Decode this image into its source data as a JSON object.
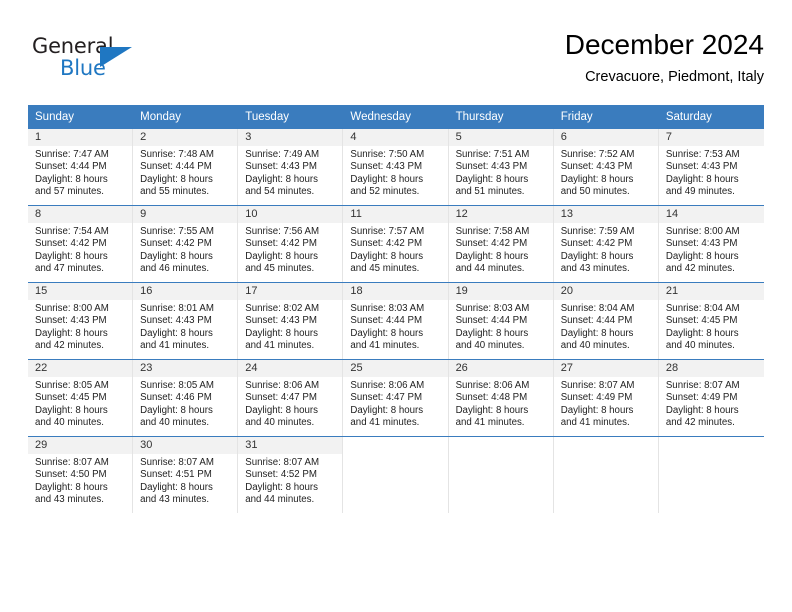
{
  "brand": {
    "name_top": "General",
    "name_bottom": "Blue",
    "triangle_color": "#1f77c2",
    "top_color": "#231f20"
  },
  "header": {
    "title": "December 2024",
    "subtitle": "Crevacuore, Piedmont, Italy"
  },
  "theme": {
    "header_bg": "#3a7cbe",
    "header_text": "#ffffff",
    "daynum_band_bg": "#f2f2f2",
    "cell_divider": "#e4e4e4",
    "row_divider": "#3a7cbe"
  },
  "weekday_headers": [
    "Sunday",
    "Monday",
    "Tuesday",
    "Wednesday",
    "Thursday",
    "Friday",
    "Saturday"
  ],
  "weeks": [
    [
      {
        "day": "1",
        "sunrise": "Sunrise: 7:47 AM",
        "sunset": "Sunset: 4:44 PM",
        "daylight1": "Daylight: 8 hours",
        "daylight2": "and 57 minutes."
      },
      {
        "day": "2",
        "sunrise": "Sunrise: 7:48 AM",
        "sunset": "Sunset: 4:44 PM",
        "daylight1": "Daylight: 8 hours",
        "daylight2": "and 55 minutes."
      },
      {
        "day": "3",
        "sunrise": "Sunrise: 7:49 AM",
        "sunset": "Sunset: 4:43 PM",
        "daylight1": "Daylight: 8 hours",
        "daylight2": "and 54 minutes."
      },
      {
        "day": "4",
        "sunrise": "Sunrise: 7:50 AM",
        "sunset": "Sunset: 4:43 PM",
        "daylight1": "Daylight: 8 hours",
        "daylight2": "and 52 minutes."
      },
      {
        "day": "5",
        "sunrise": "Sunrise: 7:51 AM",
        "sunset": "Sunset: 4:43 PM",
        "daylight1": "Daylight: 8 hours",
        "daylight2": "and 51 minutes."
      },
      {
        "day": "6",
        "sunrise": "Sunrise: 7:52 AM",
        "sunset": "Sunset: 4:43 PM",
        "daylight1": "Daylight: 8 hours",
        "daylight2": "and 50 minutes."
      },
      {
        "day": "7",
        "sunrise": "Sunrise: 7:53 AM",
        "sunset": "Sunset: 4:43 PM",
        "daylight1": "Daylight: 8 hours",
        "daylight2": "and 49 minutes."
      }
    ],
    [
      {
        "day": "8",
        "sunrise": "Sunrise: 7:54 AM",
        "sunset": "Sunset: 4:42 PM",
        "daylight1": "Daylight: 8 hours",
        "daylight2": "and 47 minutes."
      },
      {
        "day": "9",
        "sunrise": "Sunrise: 7:55 AM",
        "sunset": "Sunset: 4:42 PM",
        "daylight1": "Daylight: 8 hours",
        "daylight2": "and 46 minutes."
      },
      {
        "day": "10",
        "sunrise": "Sunrise: 7:56 AM",
        "sunset": "Sunset: 4:42 PM",
        "daylight1": "Daylight: 8 hours",
        "daylight2": "and 45 minutes."
      },
      {
        "day": "11",
        "sunrise": "Sunrise: 7:57 AM",
        "sunset": "Sunset: 4:42 PM",
        "daylight1": "Daylight: 8 hours",
        "daylight2": "and 45 minutes."
      },
      {
        "day": "12",
        "sunrise": "Sunrise: 7:58 AM",
        "sunset": "Sunset: 4:42 PM",
        "daylight1": "Daylight: 8 hours",
        "daylight2": "and 44 minutes."
      },
      {
        "day": "13",
        "sunrise": "Sunrise: 7:59 AM",
        "sunset": "Sunset: 4:42 PM",
        "daylight1": "Daylight: 8 hours",
        "daylight2": "and 43 minutes."
      },
      {
        "day": "14",
        "sunrise": "Sunrise: 8:00 AM",
        "sunset": "Sunset: 4:43 PM",
        "daylight1": "Daylight: 8 hours",
        "daylight2": "and 42 minutes."
      }
    ],
    [
      {
        "day": "15",
        "sunrise": "Sunrise: 8:00 AM",
        "sunset": "Sunset: 4:43 PM",
        "daylight1": "Daylight: 8 hours",
        "daylight2": "and 42 minutes."
      },
      {
        "day": "16",
        "sunrise": "Sunrise: 8:01 AM",
        "sunset": "Sunset: 4:43 PM",
        "daylight1": "Daylight: 8 hours",
        "daylight2": "and 41 minutes."
      },
      {
        "day": "17",
        "sunrise": "Sunrise: 8:02 AM",
        "sunset": "Sunset: 4:43 PM",
        "daylight1": "Daylight: 8 hours",
        "daylight2": "and 41 minutes."
      },
      {
        "day": "18",
        "sunrise": "Sunrise: 8:03 AM",
        "sunset": "Sunset: 4:44 PM",
        "daylight1": "Daylight: 8 hours",
        "daylight2": "and 41 minutes."
      },
      {
        "day": "19",
        "sunrise": "Sunrise: 8:03 AM",
        "sunset": "Sunset: 4:44 PM",
        "daylight1": "Daylight: 8 hours",
        "daylight2": "and 40 minutes."
      },
      {
        "day": "20",
        "sunrise": "Sunrise: 8:04 AM",
        "sunset": "Sunset: 4:44 PM",
        "daylight1": "Daylight: 8 hours",
        "daylight2": "and 40 minutes."
      },
      {
        "day": "21",
        "sunrise": "Sunrise: 8:04 AM",
        "sunset": "Sunset: 4:45 PM",
        "daylight1": "Daylight: 8 hours",
        "daylight2": "and 40 minutes."
      }
    ],
    [
      {
        "day": "22",
        "sunrise": "Sunrise: 8:05 AM",
        "sunset": "Sunset: 4:45 PM",
        "daylight1": "Daylight: 8 hours",
        "daylight2": "and 40 minutes."
      },
      {
        "day": "23",
        "sunrise": "Sunrise: 8:05 AM",
        "sunset": "Sunset: 4:46 PM",
        "daylight1": "Daylight: 8 hours",
        "daylight2": "and 40 minutes."
      },
      {
        "day": "24",
        "sunrise": "Sunrise: 8:06 AM",
        "sunset": "Sunset: 4:47 PM",
        "daylight1": "Daylight: 8 hours",
        "daylight2": "and 40 minutes."
      },
      {
        "day": "25",
        "sunrise": "Sunrise: 8:06 AM",
        "sunset": "Sunset: 4:47 PM",
        "daylight1": "Daylight: 8 hours",
        "daylight2": "and 41 minutes."
      },
      {
        "day": "26",
        "sunrise": "Sunrise: 8:06 AM",
        "sunset": "Sunset: 4:48 PM",
        "daylight1": "Daylight: 8 hours",
        "daylight2": "and 41 minutes."
      },
      {
        "day": "27",
        "sunrise": "Sunrise: 8:07 AM",
        "sunset": "Sunset: 4:49 PM",
        "daylight1": "Daylight: 8 hours",
        "daylight2": "and 41 minutes."
      },
      {
        "day": "28",
        "sunrise": "Sunrise: 8:07 AM",
        "sunset": "Sunset: 4:49 PM",
        "daylight1": "Daylight: 8 hours",
        "daylight2": "and 42 minutes."
      }
    ],
    [
      {
        "day": "29",
        "sunrise": "Sunrise: 8:07 AM",
        "sunset": "Sunset: 4:50 PM",
        "daylight1": "Daylight: 8 hours",
        "daylight2": "and 43 minutes."
      },
      {
        "day": "30",
        "sunrise": "Sunrise: 8:07 AM",
        "sunset": "Sunset: 4:51 PM",
        "daylight1": "Daylight: 8 hours",
        "daylight2": "and 43 minutes."
      },
      {
        "day": "31",
        "sunrise": "Sunrise: 8:07 AM",
        "sunset": "Sunset: 4:52 PM",
        "daylight1": "Daylight: 8 hours",
        "daylight2": "and 44 minutes."
      },
      {
        "day": "",
        "sunrise": "",
        "sunset": "",
        "daylight1": "",
        "daylight2": ""
      },
      {
        "day": "",
        "sunrise": "",
        "sunset": "",
        "daylight1": "",
        "daylight2": ""
      },
      {
        "day": "",
        "sunrise": "",
        "sunset": "",
        "daylight1": "",
        "daylight2": ""
      },
      {
        "day": "",
        "sunrise": "",
        "sunset": "",
        "daylight1": "",
        "daylight2": ""
      }
    ]
  ]
}
